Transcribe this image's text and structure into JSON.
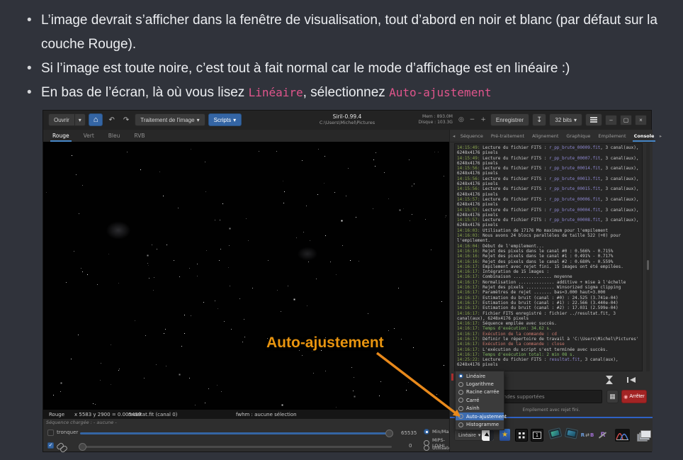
{
  "colors": {
    "accent_blue": "#3465a4",
    "code_pink": "#e0558c",
    "annotation_orange": "#e8940f",
    "stop_red": "#a32424",
    "progress_blue": "#2f62c4"
  },
  "doc": {
    "bullets": [
      [
        {
          "t": "L’image devrait s’afficher dans la fenêtre de visualisation, tout d’abord en noir et blanc (par défaut sur la couche Rouge)."
        }
      ],
      [
        {
          "t": "Si l’image est toute noire, c’est tout à fait normal car le mode d’affichage est en linéaire :)"
        }
      ],
      [
        {
          "t": "En bas de l’écran, là où vous lisez "
        },
        {
          "t": "Linéaire",
          "code": true
        },
        {
          "t": ", sélectionnez "
        },
        {
          "t": "Auto-ajustement",
          "code": true
        }
      ]
    ]
  },
  "annotation": {
    "label": "Auto-ajustement"
  },
  "titlebar": {
    "open_label": "Ouvrir",
    "processing_label": "Traitement de l'image",
    "scripts_label": "Scripts",
    "title": "Siril-0.99.4",
    "subtitle": "C:\\Users\\Michel\\Pictures",
    "mem_label": "Mem : 893.0M",
    "disk_label": "Disque : 103.3G",
    "save_label": "Enregistrer",
    "bits_label": "32 bits"
  },
  "channel_tabs": {
    "items": [
      "Rouge",
      "Vert",
      "Bleu",
      "RVB"
    ],
    "active": "Rouge"
  },
  "panel_tabs": {
    "items": [
      "Séquence",
      "Pré-traitement",
      "Alignement",
      "Graphique",
      "Empilement",
      "Console"
    ],
    "active": "Console"
  },
  "console": {
    "lines": [
      {
        "time": "14:15:49",
        "segs": [
          [
            "Lecture du fichier FITS : ",
            ""
          ],
          [
            "r_pp_brute_00009.fit",
            "file"
          ],
          [
            ", 3 canal(aux), 6248x4176 pixels",
            ""
          ]
        ]
      },
      {
        "time": "14:15:49",
        "segs": [
          [
            "Lecture du fichier FITS : ",
            ""
          ],
          [
            "r_pp_brute_00007.fit",
            "file"
          ],
          [
            ", 3 canal(aux), 6248x4176 pixels",
            ""
          ]
        ]
      },
      {
        "time": "14:15:56",
        "segs": [
          [
            "Lecture du fichier FITS : ",
            ""
          ],
          [
            "r_pp_brute_00014.fit",
            "file"
          ],
          [
            ", 3 canal(aux), 6248x4176 pixels",
            ""
          ]
        ]
      },
      {
        "time": "14:15:56",
        "segs": [
          [
            "Lecture du fichier FITS : ",
            ""
          ],
          [
            "r_pp_brute_00013.fit",
            "file"
          ],
          [
            ", 3 canal(aux), 6248x4176 pixels",
            ""
          ]
        ]
      },
      {
        "time": "14:15:56",
        "segs": [
          [
            "Lecture du fichier FITS : ",
            ""
          ],
          [
            "r_pp_brute_00015.fit",
            "file"
          ],
          [
            ", 3 canal(aux), 6248x4176 pixels",
            ""
          ]
        ]
      },
      {
        "time": "14:15:57",
        "segs": [
          [
            "Lecture du fichier FITS : ",
            ""
          ],
          [
            "r_pp_brute_00006.fit",
            "file"
          ],
          [
            ", 3 canal(aux), 6248x4176 pixels",
            ""
          ]
        ]
      },
      {
        "time": "14:15:57",
        "segs": [
          [
            "Lecture du fichier FITS : ",
            ""
          ],
          [
            "r_pp_brute_00004.fit",
            "file"
          ],
          [
            ", 3 canal(aux), 6248x4176 pixels",
            ""
          ]
        ]
      },
      {
        "time": "14:15:57",
        "segs": [
          [
            "Lecture du fichier FITS : ",
            ""
          ],
          [
            "r_pp_brute_00008.fit",
            "file"
          ],
          [
            ", 3 canal(aux), 6248x4176 pixels",
            ""
          ]
        ]
      },
      {
        "time": "14:16:03",
        "segs": [
          [
            "Utilisation de 17176 Mo maximum pour l'empilement",
            ""
          ]
        ]
      },
      {
        "time": "14:16:03",
        "segs": [
          [
            "Nous avons 24 blocs parallèles de taille 522 (+0) pour l'empilement.",
            ""
          ]
        ]
      },
      {
        "time": "14:16:04",
        "segs": [
          [
            "Début de l'empilement...",
            ""
          ]
        ]
      },
      {
        "time": "14:16:16",
        "segs": [
          [
            "Rejet des pixels dans le canal #0 : 0.566% - 0.715%",
            ""
          ]
        ]
      },
      {
        "time": "14:16:16",
        "segs": [
          [
            "Rejet des pixels dans le canal #1 : 0.491% - 0.717%",
            ""
          ]
        ]
      },
      {
        "time": "14:16:16",
        "segs": [
          [
            "Rejet des pixels dans le canal #2 : 0.680% - 0.559%",
            ""
          ]
        ]
      },
      {
        "time": "14:16:17",
        "segs": [
          [
            "Empilement avec rejet fini. 15 images ont été empilées.",
            ""
          ]
        ]
      },
      {
        "time": "14:16:17",
        "segs": [
          [
            "Intégration de 15 images :",
            ""
          ]
        ]
      },
      {
        "time": "14:16:17",
        "segs": [
          [
            "Combinaison ............... moyenne",
            ""
          ]
        ]
      },
      {
        "time": "14:16:17",
        "segs": [
          [
            "Normalisation .............. additive + mise à l'échelle",
            ""
          ]
        ]
      },
      {
        "time": "14:16:17",
        "segs": [
          [
            "Rejet des pixels ........... Winsorized sigma clipping",
            ""
          ]
        ]
      },
      {
        "time": "14:16:17",
        "segs": [
          [
            "Paramètres de rejet ....... bas=3.000 haut=3.000",
            ""
          ]
        ]
      },
      {
        "time": "14:16:17",
        "segs": [
          [
            "Estimation du bruit (canal : #0) : 24.525 (3.741e-04)",
            ""
          ]
        ]
      },
      {
        "time": "14:16:17",
        "segs": [
          [
            "Estimation du bruit (canal : #1) : 22.566 (3.440e-04)",
            ""
          ]
        ]
      },
      {
        "time": "14:16:17",
        "segs": [
          [
            "Estimation du bruit (canal : #2) : 17.031 (2.599e-04)",
            ""
          ]
        ]
      },
      {
        "time": "14:16:17",
        "segs": [
          [
            "Fichier FITS enregistré : fichier ../resultat.fit, 3 canal(aux), 6248x4176 pixels",
            ""
          ]
        ]
      },
      {
        "time": "14:16:17",
        "segs": [
          [
            "Séquence empilée avec succès.",
            ""
          ]
        ]
      },
      {
        "time": "14:16:17",
        "segs": [
          [
            "Temps d'exécution: 34.62 s.",
            "g"
          ]
        ]
      },
      {
        "time": "14:16:17",
        "segs": [
          [
            "Exécution de la commande : cd",
            "r"
          ]
        ]
      },
      {
        "time": "14:16:17",
        "segs": [
          [
            "Définir le répertoire de travail à 'C:\\Users\\Michel\\Pictures'",
            ""
          ]
        ]
      },
      {
        "time": "14:16:17",
        "segs": [
          [
            "Exécution de la commande : close",
            "r"
          ]
        ]
      },
      {
        "time": "14:16:17",
        "segs": [
          [
            "L'exécution du script s'est terminée avec succès.",
            ""
          ]
        ]
      },
      {
        "time": "14:16:17",
        "segs": [
          [
            "Temps d'exécution total: 2 min 08 s.",
            "g"
          ]
        ]
      },
      {
        "time": "14:25:22",
        "segs": [
          [
            "Lecture du fichier FITS : ",
            ""
          ],
          [
            "resultat.fit",
            "file"
          ],
          [
            ", 3 canal(aux), 6248x4176 pixels",
            ""
          ]
        ]
      }
    ]
  },
  "command": {
    "placeholder": "liste des commandes supportées",
    "stop_label": "Arrêter"
  },
  "progress": {
    "text": "Empilement avec rejet fini."
  },
  "display": {
    "mode_label": "Linéaire",
    "menu_items": [
      "Linéaire",
      "Logarithme",
      "Racine carrée",
      "Carré",
      "Asinh",
      "Auto-ajustement",
      "Histogramme"
    ],
    "selected_item": "Linéaire",
    "highlighted_item": "Auto-ajustement"
  },
  "status": {
    "channel": "Rouge",
    "coords": "x 5583 y 2900 = 0.005499",
    "file": "resultat.fit (canal 0)",
    "fwhm": "fwhm : aucune sélection",
    "sequence": "Séquence chargée : - aucune -"
  },
  "levels": {
    "truncate_label": "tronquer",
    "hi_value": "65535",
    "lo_value": "0",
    "radios": {
      "items": [
        "Min/Max",
        "MIPS-LO/HI",
        "Utilisateur"
      ],
      "selected": "Min/Max"
    }
  },
  "icons": {
    "home": "⌂",
    "undo": "↶",
    "redo": "↷",
    "caret": "▾",
    "zoom_fit": "◎",
    "zoom_out": "−",
    "zoom_in": "+",
    "save_as": "↧",
    "minimize": "–",
    "maximize": "▢",
    "close": "×",
    "tab_prev": "◂",
    "tab_next": "▸",
    "keyboard": "▦",
    "stop_dot": "◉",
    "star": "★",
    "swap_left": "R",
    "swap_arrows": "⇄",
    "swap_right": "B",
    "pick_letter": "R"
  }
}
